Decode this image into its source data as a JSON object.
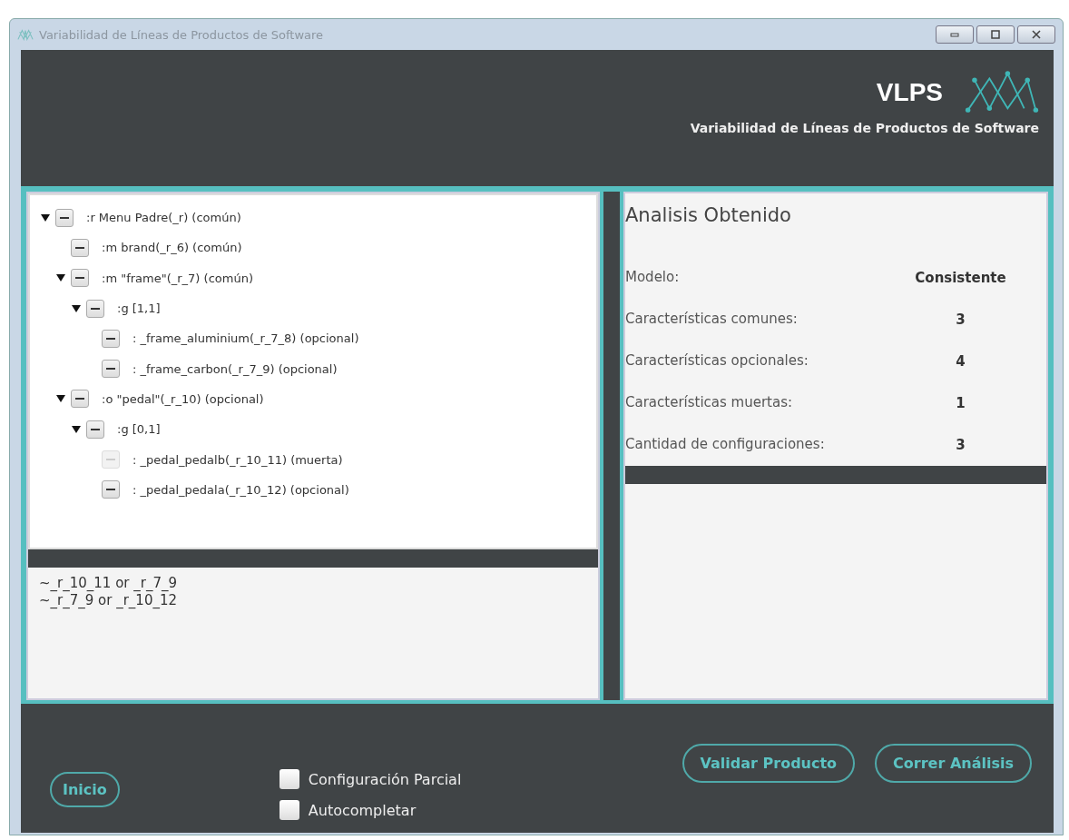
{
  "window": {
    "title": "Variabilidad de Líneas de Productos de Software"
  },
  "header": {
    "logo_text": "VLPS",
    "subtitle": "Variabilidad de Líneas de Productos de Software"
  },
  "tree": [
    {
      "label": ":r Menu Padre(_r)  (común)",
      "expanded": true,
      "disabled": false,
      "children": [
        {
          "label": ":m brand(_r_6)  (común)",
          "disabled": false
        },
        {
          "label": ":m \"frame\"(_r_7)  (común)",
          "expanded": true,
          "disabled": false,
          "children": [
            {
              "label": ":g [1,1]",
              "expanded": true,
              "disabled": false,
              "children": [
                {
                  "label": ": _frame_aluminium(_r_7_8)  (opcional)",
                  "disabled": false
                },
                {
                  "label": ": _frame_carbon(_r_7_9)  (opcional)",
                  "disabled": false
                }
              ]
            }
          ]
        },
        {
          "label": ":o \"pedal\"(_r_10)  (opcional)",
          "expanded": true,
          "disabled": false,
          "children": [
            {
              "label": ":g [0,1]",
              "expanded": true,
              "disabled": false,
              "children": [
                {
                  "label": ": _pedal_pedalb(_r_10_11)  (muerta)",
                  "disabled": true
                },
                {
                  "label": ": _pedal_pedala(_r_10_12)  (opcional)",
                  "disabled": false
                }
              ]
            }
          ]
        }
      ]
    }
  ],
  "constraints": [
    "~_r_10_11 or _r_7_9",
    "~_r_7_9 or _r_10_12"
  ],
  "analysis": {
    "title": "Analisis Obtenido",
    "rows": [
      {
        "label": "Modelo:",
        "value": "Consistente"
      },
      {
        "label": "Características comunes:",
        "value": "3"
      },
      {
        "label": "Características opcionales:",
        "value": "4"
      },
      {
        "label": "Características muertas:",
        "value": "1"
      },
      {
        "label": "Cantidad de configuraciones:",
        "value": "3"
      }
    ]
  },
  "footer": {
    "home_button": "Inicio",
    "options": [
      {
        "label": "Configuración Parcial",
        "checked": false
      },
      {
        "label": "Autocompletar",
        "checked": false
      }
    ],
    "buttons": [
      "Validar Producto",
      "Correr Análisis"
    ]
  }
}
